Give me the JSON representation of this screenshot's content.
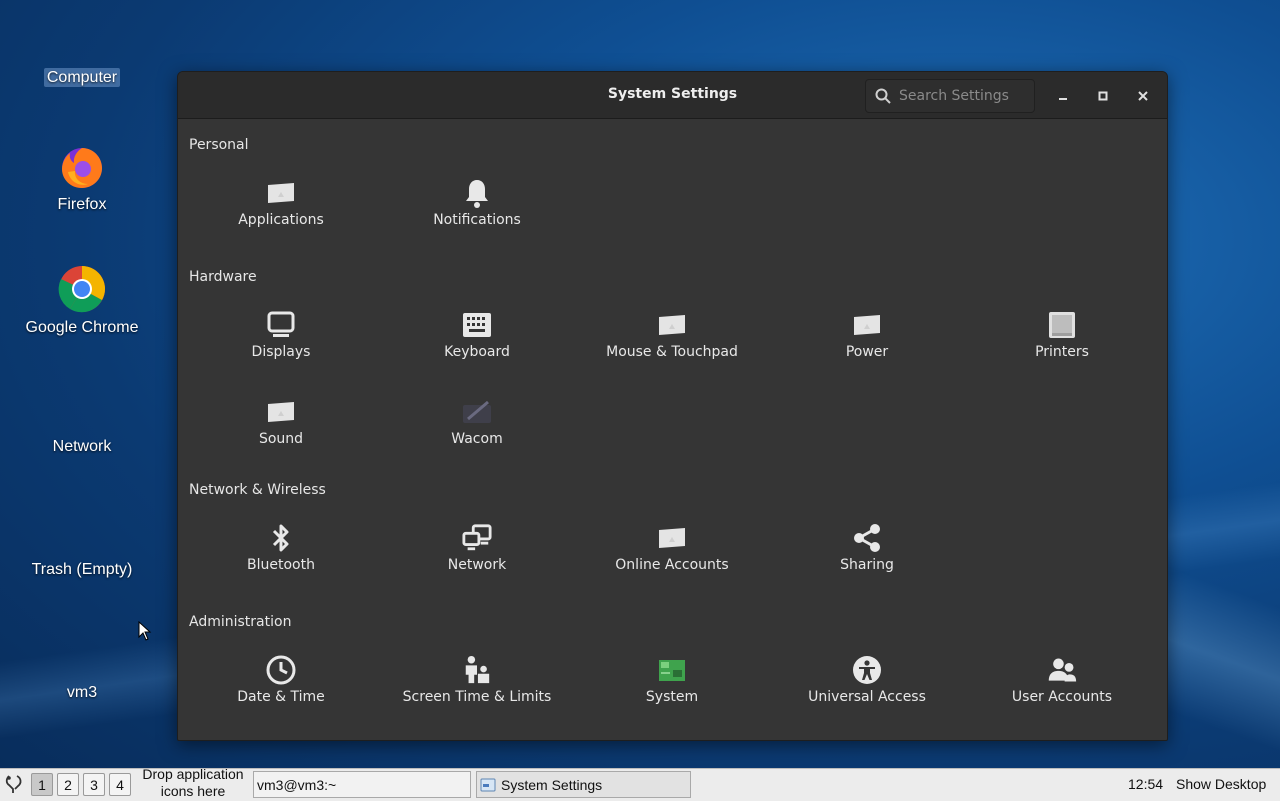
{
  "desktop": {
    "icons": [
      {
        "label": "Computer"
      },
      {
        "label": "Firefox"
      },
      {
        "label": "Google Chrome"
      },
      {
        "label": "Network"
      },
      {
        "label": "Trash (Empty)"
      },
      {
        "label": "vm3"
      }
    ]
  },
  "window": {
    "title": "System Settings",
    "search_placeholder": "Search Settings"
  },
  "sections": [
    {
      "title": "Personal",
      "items": [
        {
          "label": "Applications"
        },
        {
          "label": "Notifications"
        }
      ]
    },
    {
      "title": "Hardware",
      "items": [
        {
          "label": "Displays"
        },
        {
          "label": "Keyboard"
        },
        {
          "label": "Mouse & Touchpad"
        },
        {
          "label": "Power"
        },
        {
          "label": "Printers"
        },
        {
          "label": "Sound"
        },
        {
          "label": "Wacom"
        }
      ]
    },
    {
      "title": "Network & Wireless",
      "items": [
        {
          "label": "Bluetooth"
        },
        {
          "label": "Network"
        },
        {
          "label": "Online Accounts"
        },
        {
          "label": "Sharing"
        }
      ]
    },
    {
      "title": "Administration",
      "items": [
        {
          "label": "Date & Time"
        },
        {
          "label": "Screen Time & Limits"
        },
        {
          "label": "System"
        },
        {
          "label": "Universal Access"
        },
        {
          "label": "User Accounts"
        }
      ]
    }
  ],
  "taskbar": {
    "workspaces": [
      "1",
      "2",
      "3",
      "4"
    ],
    "drop_text_1": "Drop application",
    "drop_text_2": "icons here",
    "tasks": [
      {
        "label": "vm3@vm3:~"
      },
      {
        "label": "System Settings"
      }
    ],
    "clock": "12:54",
    "show_desktop": "Show Desktop"
  }
}
